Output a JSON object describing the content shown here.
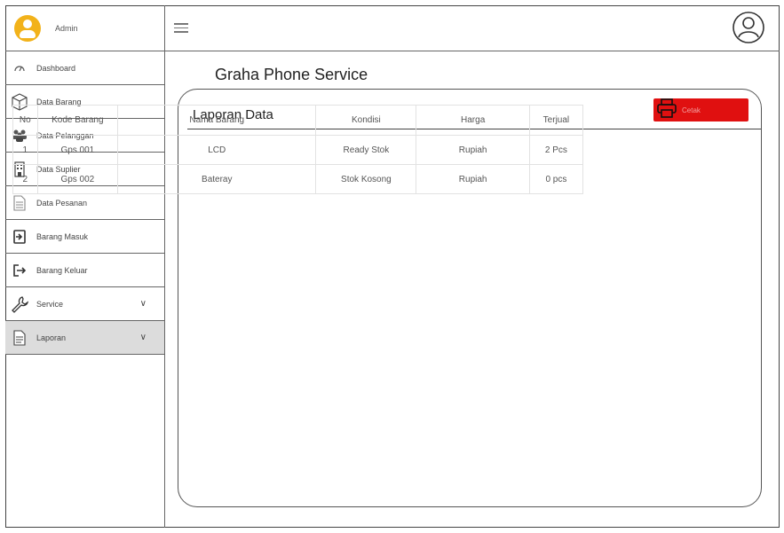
{
  "header": {
    "admin_name": "Admin"
  },
  "sidebar": {
    "items": [
      {
        "label": "Dashboard"
      },
      {
        "label": "Data Barang"
      },
      {
        "label": "Data Pelanggan"
      },
      {
        "label": "Data Suplier"
      },
      {
        "label": "Data Pesanan"
      },
      {
        "label": "Barang Masuk"
      },
      {
        "label": "Barang Keluar"
      },
      {
        "label": "Service"
      },
      {
        "label": "Laporan"
      }
    ]
  },
  "main": {
    "page_title": "Graha Phone Service",
    "panel_title": "Laporan Data",
    "print_button": "Cetak",
    "table": {
      "headers": [
        "No",
        "Kode Barang",
        "Nama Barang",
        "Kondisi",
        "Harga",
        "Terjual"
      ],
      "rows": [
        [
          "1",
          "Gps 001",
          "LCD",
          "Ready Stok",
          "Rupiah",
          "2 Pcs"
        ],
        [
          "2",
          "Gps 002",
          "Bateray",
          "Stok Kosong",
          "Rupiah",
          "0 pcs"
        ]
      ]
    }
  },
  "colors": {
    "avatar": "#f2b21a",
    "print_button": "#e01010",
    "active_menu": "#dcdcdc"
  }
}
